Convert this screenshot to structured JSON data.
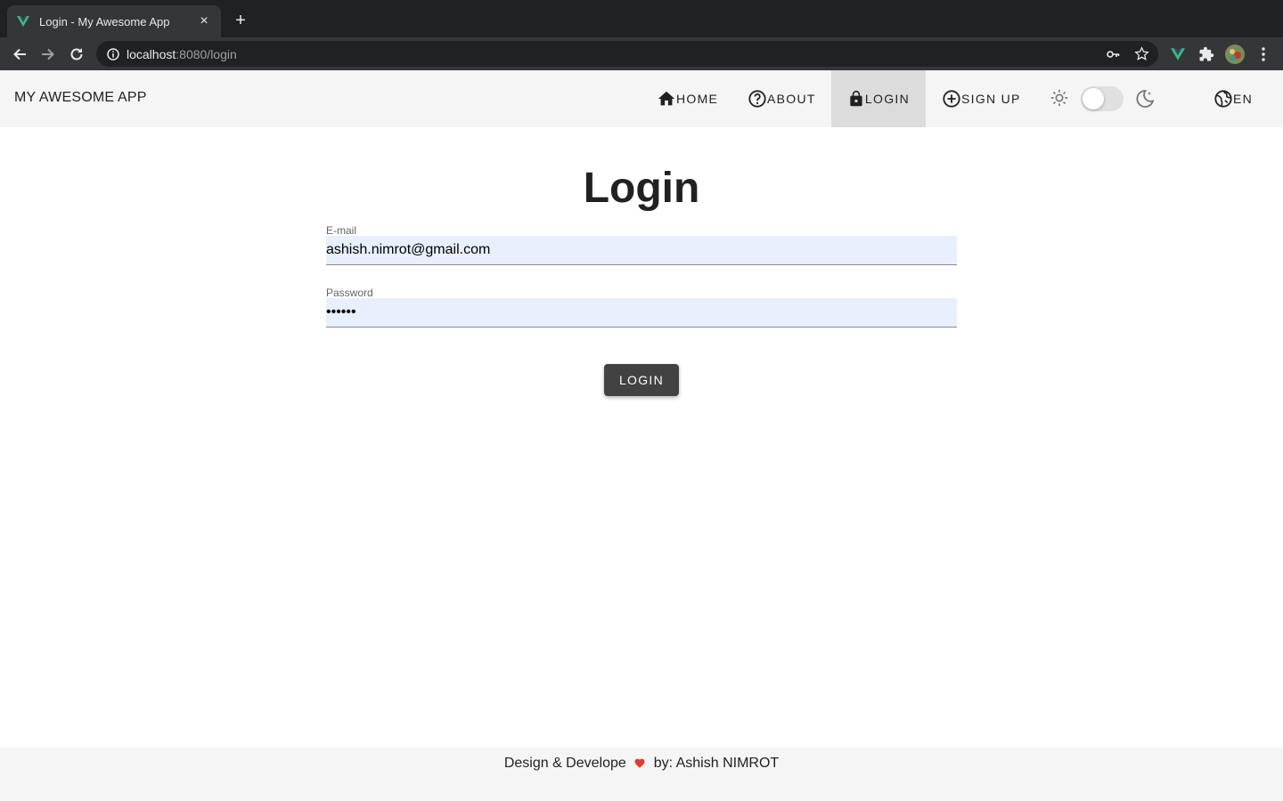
{
  "browser": {
    "tab_title": "Login - My Awesome App",
    "new_tab_label": "+",
    "close_label": "×",
    "url_host": "localhost",
    "url_rest": ":8080/login"
  },
  "appbar": {
    "title": "MY AWESOME APP",
    "nav": {
      "home": "HOME",
      "about": "ABOUT",
      "login": "LOGIN",
      "signup": "SIGN UP"
    },
    "theme_dark": false,
    "language": "EN"
  },
  "main": {
    "title": "Login",
    "email_label": "E-mail",
    "email_value": "ashish.nimrot@gmail.com",
    "password_label": "Password",
    "password_value": "••••••",
    "login_button": "LOGIN"
  },
  "footer": {
    "before": "Design & Develope",
    "after": "by: Ashish NIMROT"
  },
  "colors": {
    "appbar_bg": "#f5f5f5",
    "active_nav": "#dcdcdc",
    "autofill_bg": "#e8f0fe",
    "button_bg": "#424242",
    "heart": "#e53935",
    "vue_green": "#41b883"
  },
  "icons": [
    "vue-icon",
    "back-icon",
    "forward-icon",
    "reload-icon",
    "info-icon",
    "key-icon",
    "star-icon",
    "puzzle-icon",
    "profile-icon",
    "menu-icon",
    "home-icon",
    "help-icon",
    "lock-icon",
    "add-circle-icon",
    "sun-icon",
    "moon-icon",
    "globe-icon",
    "heart-icon"
  ]
}
